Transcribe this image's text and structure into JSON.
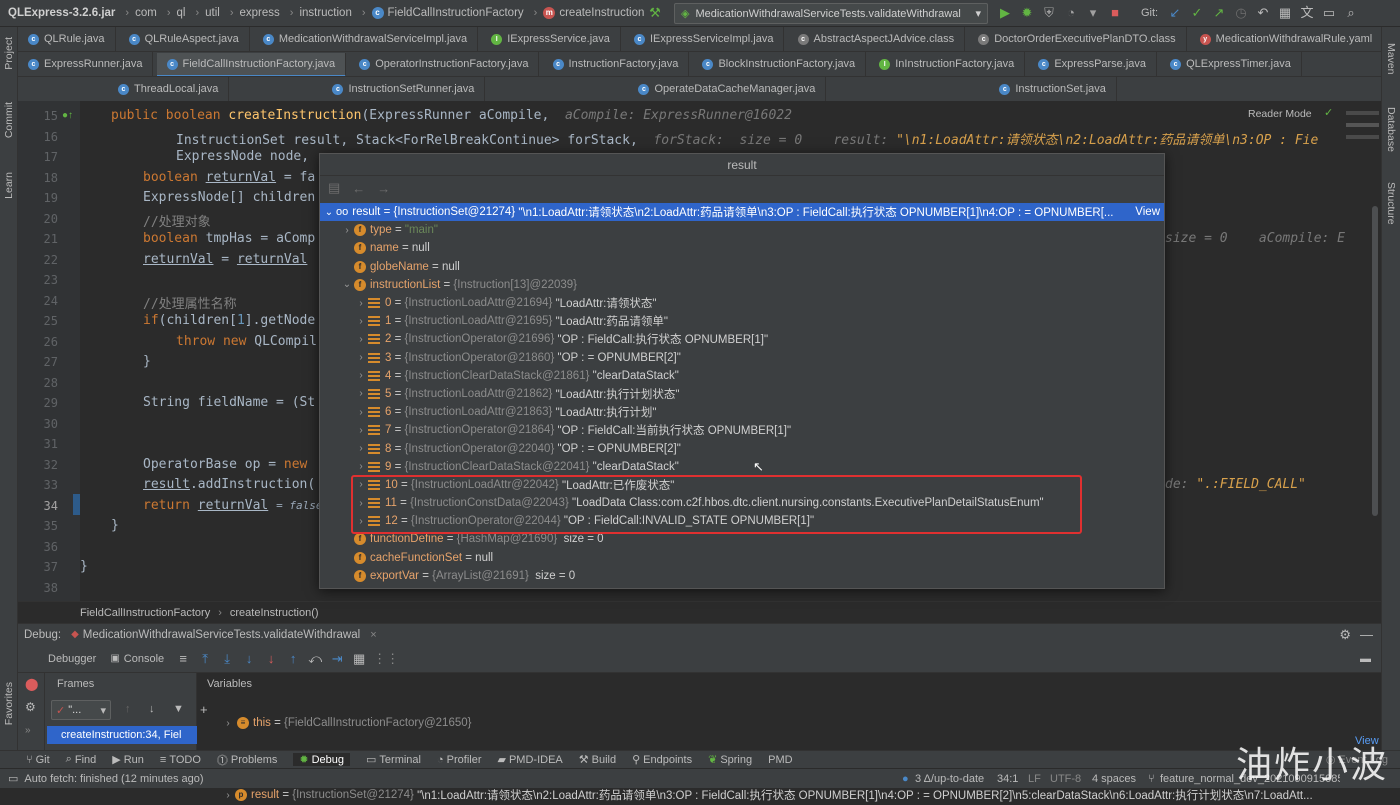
{
  "navbar": {
    "project": "QLExpress-3.2.6.jar",
    "crumbs": [
      "com",
      "ql",
      "util",
      "express",
      "instruction",
      "FieldCallInstructionFactory",
      "createInstruction"
    ],
    "run_config": "MedicationWithdrawalServiceTests.validateWithdrawal",
    "git_label": "Git:"
  },
  "tabs_row1": [
    {
      "label": "QLRule.java",
      "icon": "class-icon"
    },
    {
      "label": "QLRuleAspect.java",
      "icon": "class-icon"
    },
    {
      "label": "MedicationWithdrawalServiceImpl.java",
      "icon": "class-icon"
    },
    {
      "label": "IExpressService.java",
      "icon": "interface-icon"
    },
    {
      "label": "IExpressServiceImpl.java",
      "icon": "class-icon"
    },
    {
      "label": "AbstractAspectJAdvice.class",
      "icon": "class-icon"
    },
    {
      "label": "DoctorOrderExecutivePlanDTO.class",
      "icon": "class-icon"
    },
    {
      "label": "MedicationWithdrawalRule.yaml",
      "icon": "yaml-icon"
    }
  ],
  "tabs_row2": [
    {
      "label": "ExpressRunner.java",
      "icon": "class-icon",
      "active": false
    },
    {
      "label": "FieldCallInstructionFactory.java",
      "icon": "class-icon",
      "active": true
    },
    {
      "label": "OperatorInstructionFactory.java",
      "icon": "class-icon",
      "active": false
    },
    {
      "label": "InstructionFactory.java",
      "icon": "class-icon",
      "active": false
    },
    {
      "label": "BlockInstructionFactory.java",
      "icon": "class-icon",
      "active": false
    },
    {
      "label": "InInstructionFactory.java",
      "icon": "class-icon",
      "active": false
    },
    {
      "label": "ExpressParse.java",
      "icon": "class-icon",
      "active": false
    },
    {
      "label": "QLExpressTimer.java",
      "icon": "class-icon",
      "active": false
    }
  ],
  "tabs_row3": [
    {
      "label": "ThreadLocal.java",
      "icon": "class-icon"
    },
    {
      "label": "InstructionSetRunner.java",
      "icon": "class-icon"
    },
    {
      "label": "OperateDataCacheManager.java",
      "icon": "class-icon"
    },
    {
      "label": "InstructionSet.java",
      "icon": "class-icon"
    }
  ],
  "side_left": [
    "Project",
    "Commit",
    "Learn"
  ],
  "side_right": [
    "Maven",
    "Database",
    "Structure"
  ],
  "editor": {
    "reader_mode": "Reader Mode",
    "line_numbers": [
      "15",
      "16",
      "17",
      "18",
      "19",
      "20",
      "21",
      "22",
      "23",
      "24",
      "25",
      "26",
      "27",
      "28",
      "29",
      "30",
      "31",
      "32",
      "33",
      "34",
      "35",
      "36",
      "37",
      "38"
    ],
    "current_line": "34"
  },
  "breadcrumb": {
    "class": "FieldCallInstructionFactory",
    "method": "createInstruction()"
  },
  "popup": {
    "title": "result",
    "root": {
      "name": "result",
      "type": "{InstructionSet@21274}",
      "value": "\"\\n1:LoadAttr:请领状态\\n2:LoadAttr:药品请领单\\n3:OP : FieldCall:执行状态 OPNUMBER[1]\\n4:OP : = OPNUMBER[...",
      "view_link": "View"
    },
    "fields": [
      {
        "name": "type",
        "value": "\"main\"",
        "kind": "string"
      },
      {
        "name": "name",
        "value": "null",
        "kind": "plain"
      },
      {
        "name": "globeName",
        "value": "null",
        "kind": "plain"
      }
    ],
    "instruction_list": {
      "name": "instructionList",
      "type": "{Instruction[13]@22039}"
    },
    "items": [
      {
        "idx": "0",
        "type": "{InstructionLoadAttr@21694}",
        "value": "\"LoadAttr:请领状态\""
      },
      {
        "idx": "1",
        "type": "{InstructionLoadAttr@21695}",
        "value": "\"LoadAttr:药品请领单\""
      },
      {
        "idx": "2",
        "type": "{InstructionOperator@21696}",
        "value": "\"OP : FieldCall:执行状态 OPNUMBER[1]\""
      },
      {
        "idx": "3",
        "type": "{InstructionOperator@21860}",
        "value": "\"OP : = OPNUMBER[2]\""
      },
      {
        "idx": "4",
        "type": "{InstructionClearDataStack@21861}",
        "value": "\"clearDataStack\""
      },
      {
        "idx": "5",
        "type": "{InstructionLoadAttr@21862}",
        "value": "\"LoadAttr:执行计划状态\""
      },
      {
        "idx": "6",
        "type": "{InstructionLoadAttr@21863}",
        "value": "\"LoadAttr:执行计划\""
      },
      {
        "idx": "7",
        "type": "{InstructionOperator@21864}",
        "value": "\"OP : FieldCall:当前执行状态 OPNUMBER[1]\""
      },
      {
        "idx": "8",
        "type": "{InstructionOperator@22040}",
        "value": "\"OP : = OPNUMBER[2]\""
      },
      {
        "idx": "9",
        "type": "{InstructionClearDataStack@22041}",
        "value": "\"clearDataStack\""
      },
      {
        "idx": "10",
        "type": "{InstructionLoadAttr@22042}",
        "value": "\"LoadAttr:已作废状态\""
      },
      {
        "idx": "11",
        "type": "{InstructionConstData@22043}",
        "value": "\"LoadData Class:com.c2f.hbos.dtc.client.nursing.constants.ExecutivePlanDetailStatusEnum\""
      },
      {
        "idx": "12",
        "type": "{InstructionOperator@22044}",
        "value": "\"OP : FieldCall:INVALID_STATE OPNUMBER[1]\""
      }
    ],
    "tail": [
      {
        "name": "functionDefine",
        "type": "{HashMap@21690}",
        "value": "size = 0",
        "expandable": true
      },
      {
        "name": "cacheFunctionSet",
        "type": "",
        "value": "null",
        "expandable": false
      },
      {
        "name": "exportVar",
        "type": "{ArrayList@21691}",
        "value": "size = 0",
        "expandable": true
      }
    ]
  },
  "debug": {
    "label": "Debug:",
    "session": "MedicationWithdrawalServiceTests.validateWithdrawal",
    "tabs": [
      "Debugger",
      "Console"
    ],
    "frames_label": "Frames",
    "variables_label": "Variables",
    "thread_select": "\"...",
    "current_frame": "createInstruction:34, Fiel",
    "variables": [
      {
        "name": "this",
        "type": "{FieldCallInstructionFactory@21650}",
        "value": ""
      },
      {
        "name": "aCompile",
        "type": "{ExpressRunner@16022}",
        "value": ""
      },
      {
        "name": "result",
        "type": "{InstructionSet@21274}",
        "value": "\"\\n1:LoadAttr:请领状态\\n2:LoadAttr:药品请领单\\n3:OP : FieldCall:执行状态 OPNUMBER[1]\\n4:OP : = OPNUMBER[2]\\n5:clearDataStack\\n6:LoadAttr:执行计划状态\\n7:LoadAtt..."
      }
    ],
    "view": "View"
  },
  "bottom_tools": [
    "Git",
    "Find",
    "Run",
    "TODO",
    "Problems",
    "Debug",
    "Terminal",
    "Profiler",
    "PMD-IDEA",
    "Build",
    "Endpoints",
    "Spring",
    "PMD"
  ],
  "side_bottom": [
    "Favorites"
  ],
  "status": {
    "message": "Auto fetch: finished (12 minutes ago)",
    "vcs": "3 Δ/up-to-date",
    "position": "34:1",
    "line_sep": "LF",
    "encoding": "UTF-8",
    "indent": "4 spaces",
    "branch": "feature_normal_dev_20210909150851",
    "event_log": "Event Log"
  },
  "watermark": "油炸小波",
  "colors": {
    "accent": "#2f65ca",
    "highlight_box": "#e03030",
    "field_badge": "#d68b2c"
  }
}
